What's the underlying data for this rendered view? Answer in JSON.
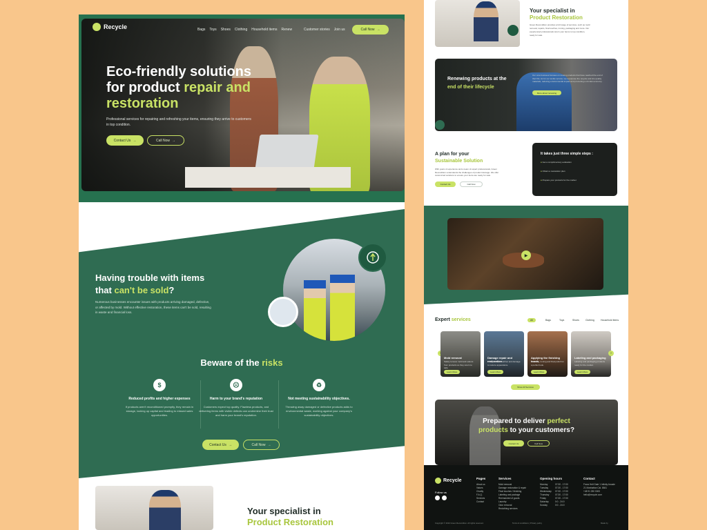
{
  "brand": {
    "name": "Recycle"
  },
  "nav": {
    "items": [
      "Bags",
      "Toys",
      "Shoes",
      "Clothing",
      "Household items",
      "Renew",
      "Customer stories",
      "Join us"
    ],
    "cta": "Call Now"
  },
  "hero": {
    "title_a": "Eco-friendly solutions",
    "title_b": "for product",
    "title_accent": "repair and restoration",
    "subtitle": "Professional services for repairing and refreshing your items, ensuring they arrive to customers in top condition.",
    "btn_primary": "Contact Us",
    "btn_secondary": "Call Now"
  },
  "trouble": {
    "title_a": "Having trouble with items",
    "title_b": "that",
    "title_accent": "can't be sold",
    "title_end": "?",
    "body": "Numerous businesses encounter issues with products arriving damaged, defective, or affected by mold. Without effective restoration, these items can't be sold, resulting in waste and financial loss."
  },
  "risks": {
    "title_a": "Beware of the",
    "title_accent": "risks",
    "items": [
      {
        "title": "Reduced profits and higher expenses",
        "body": "If products aren't reconditioned promptly, they remain in storage, locking up capital and leading to missed sales opportunities."
      },
      {
        "title": "Harm to your brand's reputation",
        "body": "Customers expect top quality. Flawless products, and delivering items with visible defects can undermine their trust and harm your brand's reputation."
      },
      {
        "title": "Not meeting sustainability objectives.",
        "body": "Throwing away damaged or defective products adds to environmental waste, working against your company's sustainability objectives."
      }
    ],
    "btn_primary": "Contact Us",
    "btn_secondary": "Call Now"
  },
  "specialist": {
    "title_a": "Your specialist in",
    "title_accent": "Product Restoration",
    "body": "Green Recondition provides a full range of services, such as mold removal, repairs, final touches, ironing, packaging and more. Our experienced professionals return your items to top condition, ready for sale."
  },
  "renewing": {
    "title_a": "Renewing products at the",
    "title_accent": "end of their lifecycle",
    "body": "Our core business focuses on reusing products that have reached the end of their life. As for our textile service, we repurpose the recycle and into quality materials, reducing environmental impact and promoting a circular economy.",
    "btn": "More about renewing"
  },
  "plan": {
    "title_a": "A plan for your",
    "title_accent": "Sustainable Solution",
    "body": "With years of experience and a team of expert professionals, Green Recondition understands the challenges of product damage. We offer customized solutions to ensure your items are ready for sale.",
    "btn_primary": "Contact Us",
    "btn_secondary": "Call Now",
    "steps_title": "It takes just three simple steps :",
    "steps": [
      "Get a complimentary evaluation",
      "Obtain a restoration plan",
      "Prepare your products for the market"
    ]
  },
  "services": {
    "title_a": "Expert",
    "title_accent": "services",
    "filters": [
      "All",
      "Bags",
      "Toys",
      "Shoes",
      "Clothing",
      "Household items"
    ],
    "cards": [
      {
        "name": "Mold removal",
        "desc": "Safely remove mold and odours from products so they return to sale.",
        "btn": "Learn More"
      },
      {
        "name": "Damage repair and restoration",
        "desc": "Fixing tears, scratches and damage to restore appearance.",
        "btn": "Learn More"
      },
      {
        "name": "Applying the finishing touch",
        "desc": "Cleaning, ironing and final polish for a perfect look.",
        "btn": "Learn More"
      },
      {
        "name": "Labeling and packaging",
        "desc": "Labeling and packaging products ready for the market.",
        "btn": "Learn More"
      }
    ],
    "show_all": "Show All Services"
  },
  "cta": {
    "title_a": "Prepared to deliver",
    "title_accent_a": "perfect",
    "title_accent_b": "products",
    "title_b": "to your customers?",
    "btn_primary": "Contact Us",
    "btn_secondary": "Call Now"
  },
  "footer": {
    "follow": "Follow us",
    "pages": {
      "title": "Pages",
      "items": [
        "About us",
        "Values",
        "Charity",
        "F.A.Q.",
        "Services",
        "Contact"
      ]
    },
    "services": {
      "title": "Services",
      "items": [
        "Mold removal",
        "Damage restoration & repair",
        "Final touches / finishing",
        "Labeling and package",
        "Reemanded of goods",
        "Laundry",
        "Odor removal",
        "Reclothing services"
      ]
    },
    "hours": {
      "title": "Opening hours",
      "rows": [
        [
          "Monday",
          "07:30 - 17:00"
        ],
        [
          "Tuesday",
          "07:30 - 17:00"
        ],
        [
          "Wednesday",
          "07:30 - 17:00"
        ],
        [
          "Thursday",
          "07:30 - 17:00"
        ],
        [
          "Friday",
          "07:30 - 17:00"
        ],
        [
          "Saturday",
          "0:0 - 24:0"
        ],
        [
          "Sunday",
          "0:0 - 24:0"
        ]
      ]
    },
    "contact": {
      "title": "Contact",
      "items": [
        "Franz Hell Gate 1 Infinity Arcade 21 Manhattan Cal. 8841",
        "+48 91 250 0000",
        "hello@recycle.com"
      ]
    },
    "copyright": "Copyright © 2024 Green Recondition. All rights reserved.",
    "terms": "Terms & conditions | Privacy policy",
    "made_by": "Made by"
  },
  "colors": {
    "accent": "#c9e265",
    "green": "#2f6c52",
    "dark": "#101311",
    "page_bg": "#f9c68b"
  }
}
